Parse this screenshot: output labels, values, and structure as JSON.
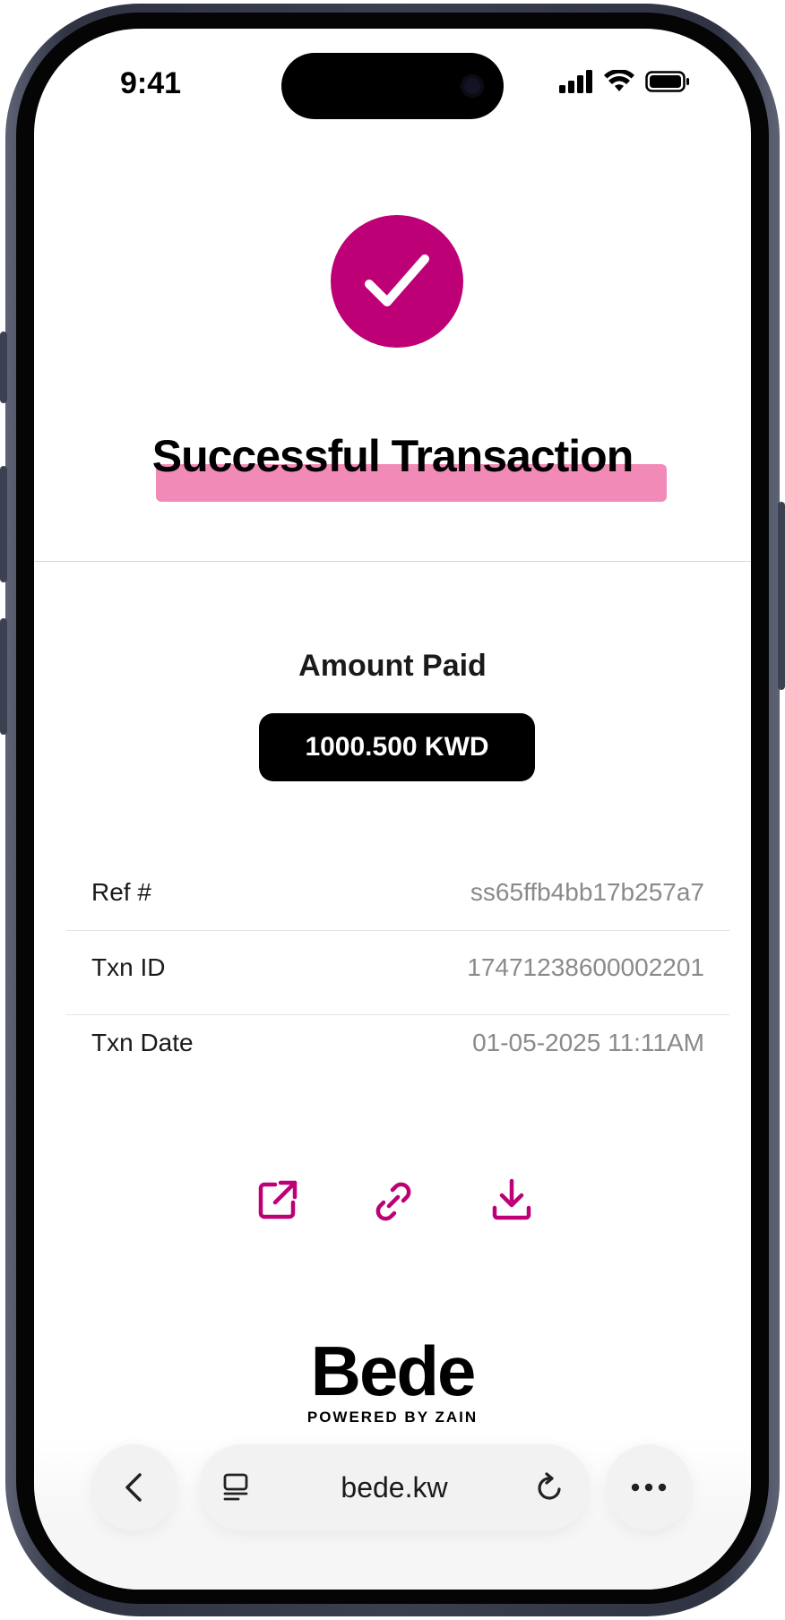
{
  "status_bar": {
    "time": "9:41"
  },
  "header": {
    "title": "Successful Transaction"
  },
  "amount": {
    "label": "Amount Paid",
    "value": "1000.500 KWD"
  },
  "details": [
    {
      "key": "Ref #",
      "value": "ss65ffb4bb17b257a7"
    },
    {
      "key": "Txn ID",
      "value": "17471238600002201"
    },
    {
      "key": "Txn Date",
      "value": "01-05-2025 11:11AM"
    }
  ],
  "actions": [
    "open-external-icon",
    "link-icon",
    "download-icon"
  ],
  "brand": {
    "logo": "Bede",
    "tagline": "POWERED BY ZAIN"
  },
  "browser": {
    "url": "bede.kw"
  },
  "colors": {
    "accent": "#be0076",
    "highlight": "#f28ab8",
    "pill": "#000000"
  }
}
